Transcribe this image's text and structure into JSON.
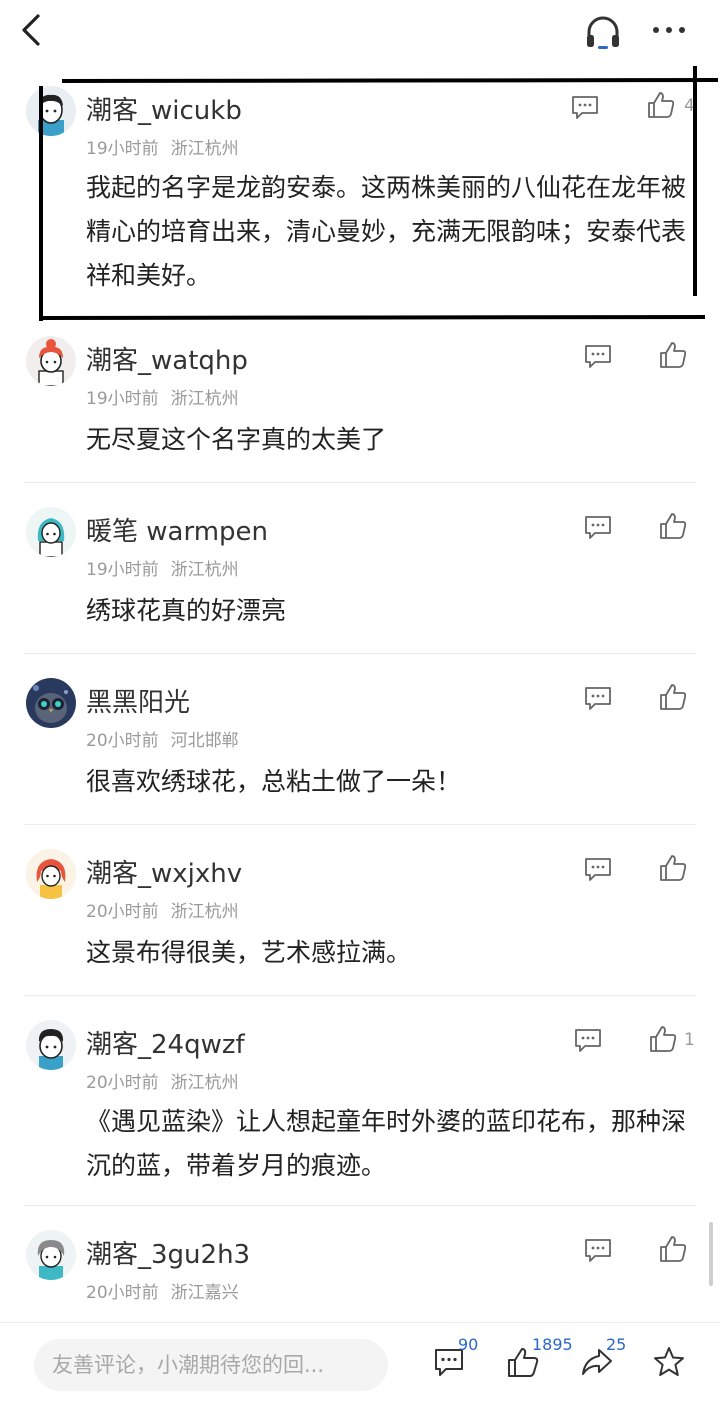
{
  "comments": [
    {
      "username": "潮客_wicukb",
      "time": "19小时前",
      "location": "浙江杭州",
      "content": "我起的名字是龙韵安泰。这两株美丽的八仙花在龙年被精心的培育出来，清心曼妙，充满无限韵味；安泰代表祥和美好。",
      "likes": "4"
    },
    {
      "username": "潮客_watqhp",
      "time": "19小时前",
      "location": "浙江杭州",
      "content": "无尽夏这个名字真的太美了",
      "likes": ""
    },
    {
      "username": "暖笔 warmpen",
      "time": "19小时前",
      "location": "浙江杭州",
      "content": "绣球花真的好漂亮",
      "likes": ""
    },
    {
      "username": "黑黑阳光",
      "time": "20小时前",
      "location": "河北邯郸",
      "content": "很喜欢绣球花，总粘土做了一朵！",
      "likes": ""
    },
    {
      "username": "潮客_wxjxhv",
      "time": "20小时前",
      "location": "浙江杭州",
      "content": "这景布得很美，艺术感拉满。",
      "likes": ""
    },
    {
      "username": "潮客_24qwzf",
      "time": "20小时前",
      "location": "浙江杭州",
      "content": "《遇见蓝染》让人想起童年时外婆的蓝印花布，那种深沉的蓝，带着岁月的痕迹。",
      "likes": "1"
    },
    {
      "username": "潮客_3gu2h3",
      "time": "20小时前",
      "location": "浙江嘉兴",
      "content": "",
      "likes": ""
    }
  ],
  "bottom_bar": {
    "input_placeholder": "友善评论，小潮期待您的回...",
    "comment_count": "90",
    "like_count": "1895",
    "share_count": "25"
  },
  "colors": {
    "accent": "#2a68c8",
    "icon": "#555555"
  }
}
